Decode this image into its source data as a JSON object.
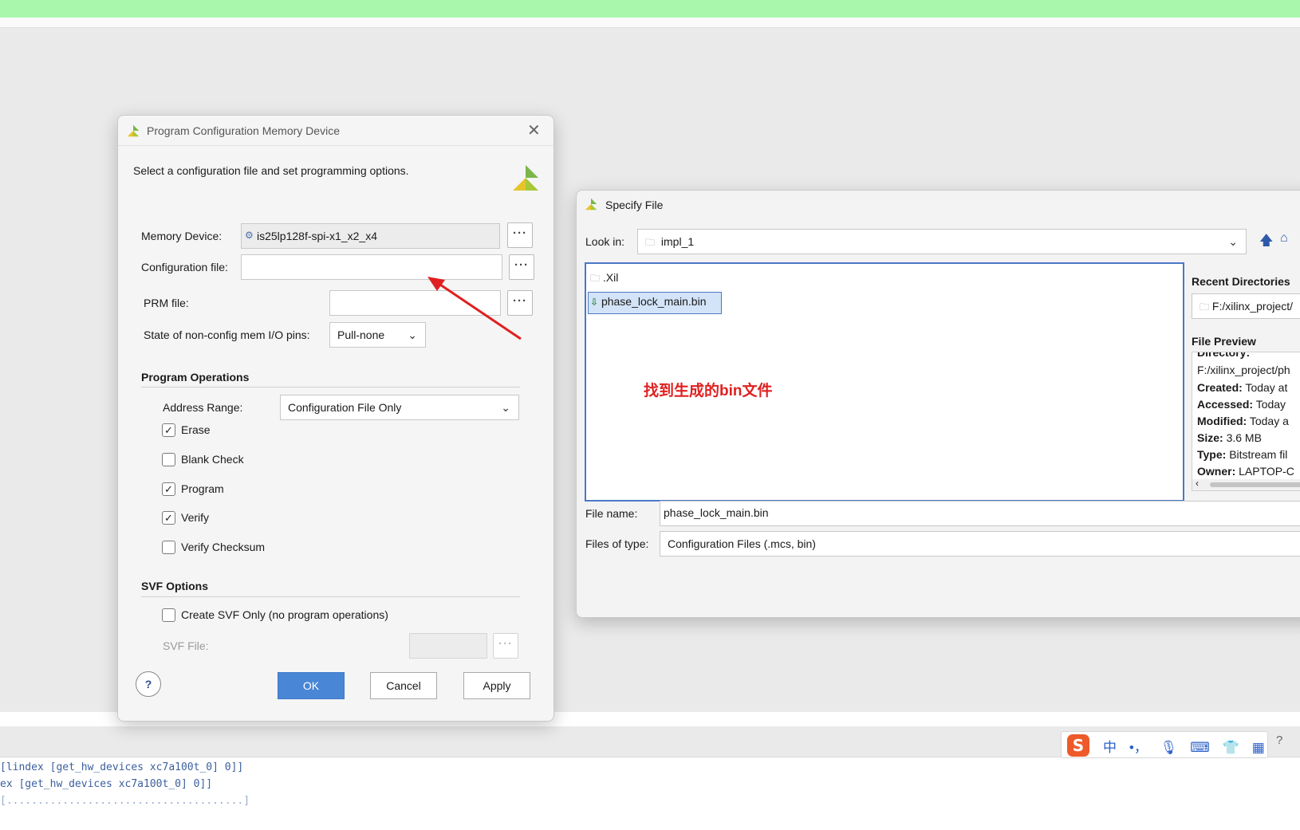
{
  "dialog1": {
    "title": "Program Configuration Memory Device",
    "instruction": "Select a configuration file and set programming options.",
    "memory_device_label": "Memory Device:",
    "memory_device_value": "is25lp128f-spi-x1_x2_x4",
    "config_file_label": "Configuration file:",
    "config_file_value": "",
    "prm_file_label": "PRM file:",
    "prm_file_value": "",
    "state_label": "State of non-config mem I/O pins:",
    "state_value": "Pull-none",
    "dots": "···",
    "program_ops_heading": "Program Operations",
    "address_range_label": "Address Range:",
    "address_range_value": "Configuration File Only",
    "checkboxes": [
      {
        "label": "Erase",
        "checked": true
      },
      {
        "label": "Blank Check",
        "checked": false
      },
      {
        "label": "Program",
        "checked": true
      },
      {
        "label": "Verify",
        "checked": true
      },
      {
        "label": "Verify Checksum",
        "checked": false
      }
    ],
    "svf_heading": "SVF Options",
    "svf_only_label": "Create SVF Only (no program operations)",
    "svf_file_label": "SVF File:",
    "help": "?",
    "ok": "OK",
    "cancel": "Cancel",
    "apply": "Apply"
  },
  "dialog2": {
    "title": "Specify File",
    "look_in_label": "Look in:",
    "look_in_value": "impl_1",
    "files": [
      {
        "name": ".Xil",
        "type": "folder"
      },
      {
        "name": "phase_lock_main.bin",
        "type": "bin",
        "selected": true
      }
    ],
    "annotation": "找到生成的bin文件",
    "recent_dirs_heading": "Recent Directories",
    "recent_dir_value": "F:/xilinx_project/",
    "file_preview_heading": "File Preview",
    "preview": {
      "directory_label": "Directory:",
      "directory_value": "F:/xilinx_project/ph",
      "created_label": "Created:",
      "created_value": "Today at",
      "accessed_label": "Accessed:",
      "accessed_value": "Today",
      "modified_label": "Modified:",
      "modified_value": "Today a",
      "size_label": "Size:",
      "size_value": "3.6 MB",
      "type_label": "Type:",
      "type_value": "Bitstream fil",
      "owner_label": "Owner:",
      "owner_value": "LAPTOP-C"
    },
    "file_name_label": "File name:",
    "file_name_value": "phase_lock_main.bin",
    "files_of_type_label": "Files of type:",
    "files_of_type_value": "Configuration Files (.mcs, bin)"
  },
  "console": {
    "lines": [
      "[lindex [get_hw_devices xc7a100t_0] 0]]",
      "ex [get_hw_devices xc7a100t_0] 0]]"
    ]
  },
  "ime": {
    "chinese": "中",
    "punct": "•，"
  },
  "colors": {
    "accent": "#4a86d6",
    "annotation_red": "#e02020",
    "top_strip": "#a9f7ad",
    "console_text": "#3b5f9e"
  }
}
